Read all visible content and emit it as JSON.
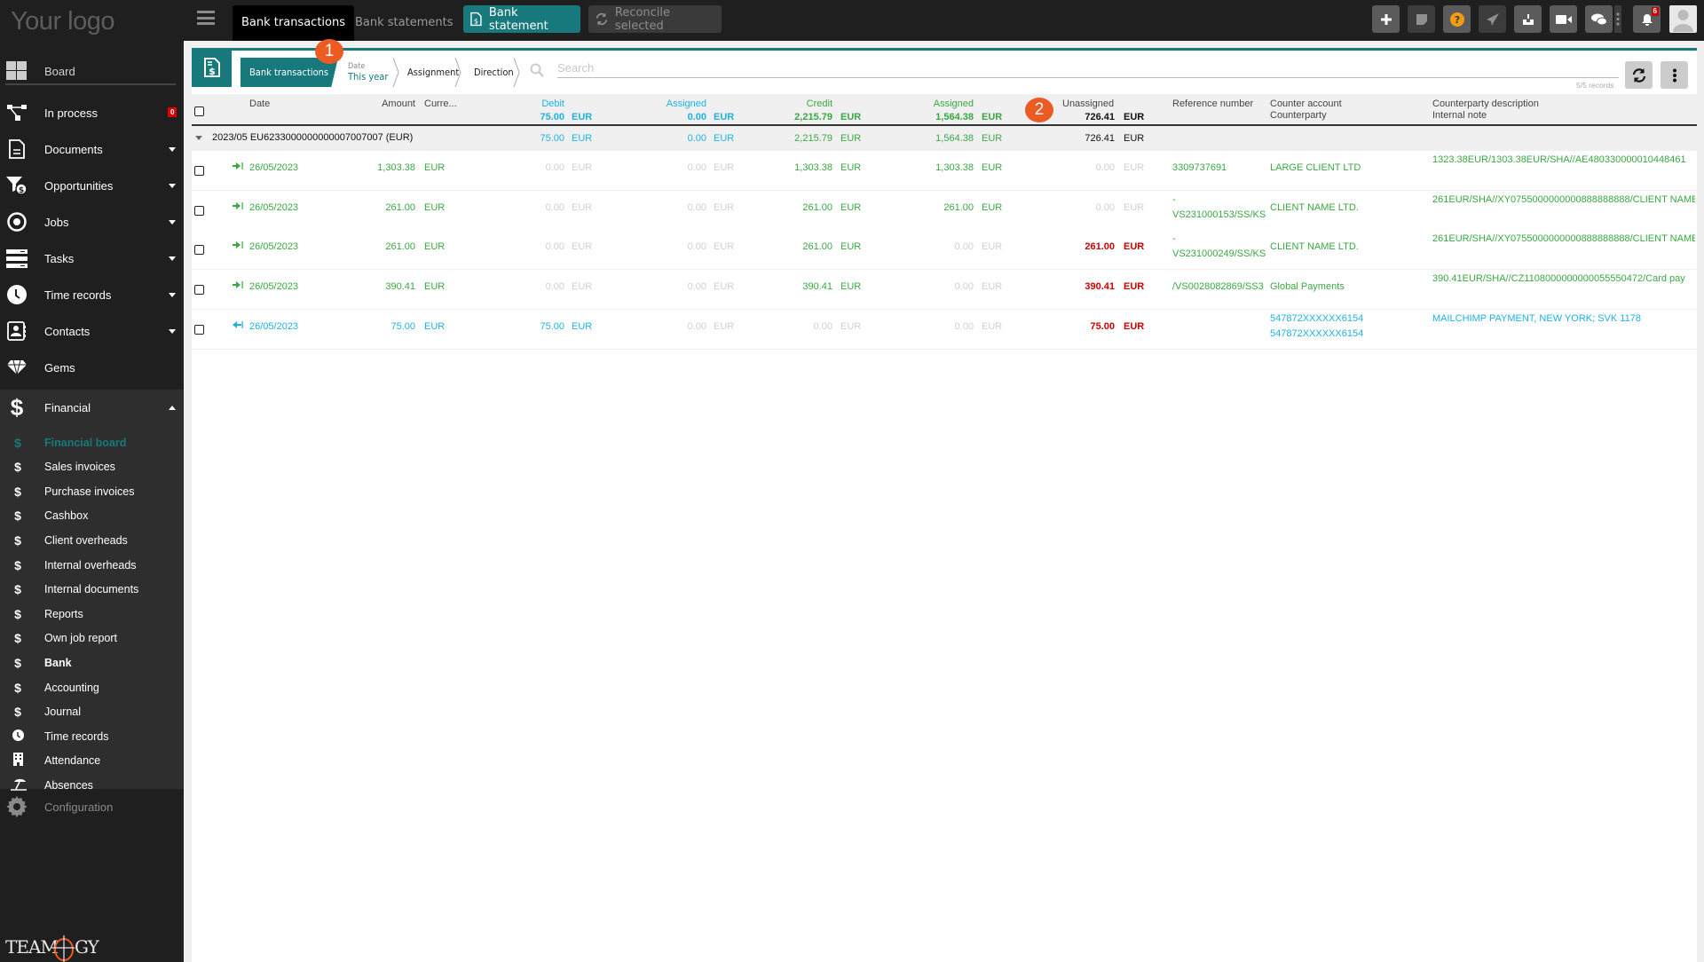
{
  "app": {
    "logo_text": "Your logo",
    "brand": "Teamogy",
    "colors": {
      "accent": "#17797b",
      "marker": "#ec5b22",
      "credit": "#3aa842",
      "debit": "#1fb1e0",
      "unassigned_alert": "#cc0000"
    }
  },
  "topbar": {
    "tabs": [
      {
        "label": "Bank transactions",
        "active": true
      },
      {
        "label": "Bank statements",
        "active": false
      }
    ],
    "buttons": {
      "bank_statement": "Bank statement",
      "reconcile_selected": "Reconcile selected"
    },
    "icons": [
      "plus-icon",
      "sticky-note-icon",
      "help-icon",
      "send-icon",
      "inbox-icon",
      "video-icon",
      "chat-icon",
      "more-vertical-icon",
      "bell-icon",
      "user-avatar"
    ],
    "notifications_count": "6"
  },
  "sidebar": {
    "items": [
      {
        "label": "Board",
        "icon": "board-icon"
      },
      {
        "label": "In process",
        "icon": "process-icon",
        "badge": "0"
      },
      {
        "label": "Documents",
        "icon": "document-icon",
        "expandable": true
      },
      {
        "label": "Opportunities",
        "icon": "funnel-icon",
        "expandable": true
      },
      {
        "label": "Jobs",
        "icon": "target-icon",
        "expandable": true
      },
      {
        "label": "Tasks",
        "icon": "tasks-icon",
        "expandable": true
      },
      {
        "label": "Time records",
        "icon": "clock-icon",
        "expandable": true
      },
      {
        "label": "Contacts",
        "icon": "contacts-icon",
        "expandable": true
      },
      {
        "label": "Gems",
        "icon": "gem-icon"
      },
      {
        "label": "Financial",
        "icon": "dollar-icon",
        "expanded": true
      }
    ],
    "financial_sub": [
      {
        "label": "Financial board",
        "icon": "$",
        "active": true
      },
      {
        "label": "Sales invoices",
        "icon": "$"
      },
      {
        "label": "Purchase invoices",
        "icon": "$"
      },
      {
        "label": "Cashbox",
        "icon": "$"
      },
      {
        "label": "Client overheads",
        "icon": "$"
      },
      {
        "label": "Internal overheads",
        "icon": "$"
      },
      {
        "label": "Internal documents",
        "icon": "$"
      },
      {
        "label": "Reports",
        "icon": "$"
      },
      {
        "label": "Own job report",
        "icon": "$"
      },
      {
        "label": "Bank",
        "icon": "$",
        "current": true
      },
      {
        "label": "Accounting",
        "icon": "$"
      },
      {
        "label": "Journal",
        "icon": "$"
      },
      {
        "label": "Time records",
        "icon": "clock"
      },
      {
        "label": "Attendance",
        "icon": "building"
      },
      {
        "label": "Absences",
        "icon": "beach"
      }
    ],
    "configuration": "Configuration"
  },
  "toolbar": {
    "breadcrumbs": {
      "view": "Bank transactions",
      "date_label": "Date",
      "date_value": "This year",
      "assignment": "Assignment",
      "direction": "Direction"
    },
    "search_placeholder": "Search",
    "records": "5/5 records"
  },
  "markers": {
    "one": "1",
    "two": "2"
  },
  "table": {
    "headers": {
      "date": "Date",
      "amount": "Amount",
      "currency": "Curre...",
      "debit": "Debit",
      "debit_assigned": "Assigned",
      "credit": "Credit",
      "credit_assigned": "Assigned",
      "unassigned": "Unassigned",
      "reference": "Reference number",
      "counter_account": "Counter account",
      "counterparty": "Counterparty",
      "cp_description": "Counterparty description",
      "internal_note": "Internal note"
    },
    "totals": {
      "debit": "75.00",
      "debit_assigned": "0.00",
      "credit": "2,215.79",
      "credit_assigned": "1,564.38",
      "unassigned": "726.41",
      "currency": "EUR"
    },
    "group": {
      "label": "2023/05 EU6233000000000007007007 (EUR)",
      "debit": "75.00",
      "debit_assigned": "0.00",
      "credit": "2,215.79",
      "credit_assigned": "1,564.38",
      "unassigned": "726.41",
      "currency": "EUR"
    },
    "rows": [
      {
        "direction": "in",
        "date": "26/05/2023",
        "amount": "1,303.38",
        "currency": "EUR",
        "debit": "0.00",
        "debit_assigned": "0.00",
        "credit": "1,303.38",
        "credit_assigned": "1,303.38",
        "unassigned": "0.00",
        "reference": "3309737691",
        "reference_line2": "",
        "counter_account": "",
        "counterparty": "LARGE CLIENT LTD",
        "description": "1323.38EUR/1303.38EUR/SHA//AE480330000010448461"
      },
      {
        "direction": "in",
        "date": "26/05/2023",
        "amount": "261.00",
        "currency": "EUR",
        "debit": "0.00",
        "debit_assigned": "0.00",
        "credit": "261.00",
        "credit_assigned": "261.00",
        "unassigned": "0.00",
        "reference": "-",
        "reference_line2": "VS231000153/SS/KS",
        "counter_account": "",
        "counterparty": "CLIENT NAME LTD.",
        "description": "261EUR/SHA//XY0755000000000888888888/CLIENT NAME"
      },
      {
        "direction": "in",
        "date": "26/05/2023",
        "amount": "261.00",
        "currency": "EUR",
        "debit": "0.00",
        "debit_assigned": "0.00",
        "credit": "261.00",
        "credit_assigned": "0.00",
        "unassigned": "261.00",
        "reference": "-",
        "reference_line2": "VS231000249/SS/KS",
        "counter_account": "",
        "counterparty": "CLIENT NAME LTD.",
        "description": "261EUR/SHA//XY0755000000000888888888/CLIENT NAME"
      },
      {
        "direction": "in",
        "date": "26/05/2023",
        "amount": "390.41",
        "currency": "EUR",
        "debit": "0.00",
        "debit_assigned": "0.00",
        "credit": "390.41",
        "credit_assigned": "0.00",
        "unassigned": "390.41",
        "reference": "/VS0028082869/SS3",
        "reference_line2": "",
        "counter_account": "",
        "counterparty": "Global Payments",
        "description": "390.41EUR/SHA//CZ1108000000000055550472/Card pay"
      },
      {
        "direction": "out",
        "date": "26/05/2023",
        "amount": "75.00",
        "currency": "EUR",
        "debit": "75.00",
        "debit_assigned": "0.00",
        "credit": "0.00",
        "credit_assigned": "0.00",
        "unassigned": "75.00",
        "reference": "",
        "reference_line2": "",
        "counter_account": "547872XXXXXX6154",
        "counterparty": "547872XXXXXX6154",
        "description": "MAILCHIMP PAYMENT, NEW YORK; SVK 1178"
      }
    ]
  }
}
